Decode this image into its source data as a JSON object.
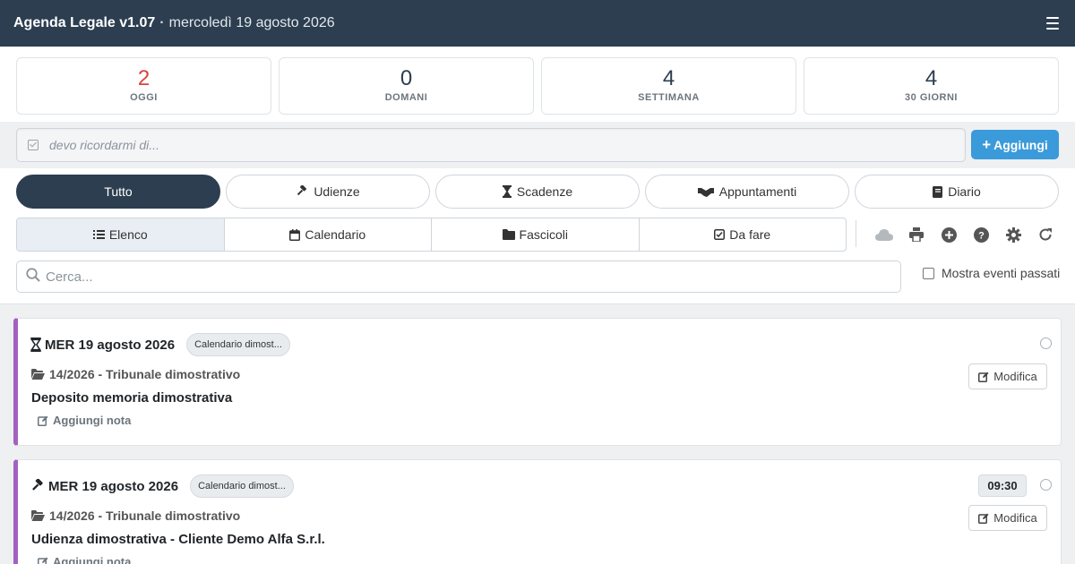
{
  "header": {
    "app_title": "Agenda Legale v1.07",
    "separator": "·",
    "current_date": "mercoledì 19 agosto 2026",
    "menu_icon": "hamburger-menu-icon"
  },
  "stats": [
    {
      "value": "2",
      "label": "OGGI",
      "color": "#d9443c"
    },
    {
      "value": "0",
      "label": "DOMANI"
    },
    {
      "value": "4",
      "label": "SETTIMANA"
    },
    {
      "value": "4",
      "label": "30 GIORNI"
    }
  ],
  "quick_add": {
    "placeholder": "devo ricordarmi di...",
    "button_label": "Aggiungi",
    "button_color": "#3b9ad9"
  },
  "filters": [
    {
      "label": "Tutto",
      "active": true
    },
    {
      "label": "Udienze",
      "icon": "gavel-icon"
    },
    {
      "label": "Scadenze",
      "icon": "hourglass-icon"
    },
    {
      "label": "Appuntamenti",
      "icon": "handshake-icon"
    },
    {
      "label": "Diario",
      "icon": "book-icon"
    }
  ],
  "views": [
    {
      "label": "Elenco",
      "icon": "list-icon",
      "active": true
    },
    {
      "label": "Calendario",
      "icon": "calendar-icon"
    },
    {
      "label": "Fascicoli",
      "icon": "folder-icon"
    },
    {
      "label": "Da fare",
      "icon": "checkbox-icon"
    }
  ],
  "toolbar_icons": [
    "cloud-icon",
    "print-icon",
    "add-circle-icon",
    "help-icon",
    "settings-icon",
    "refresh-icon"
  ],
  "search": {
    "placeholder": "Cerca..."
  },
  "show_past_label": "Mostra eventi passati",
  "events": [
    {
      "type_icon": "hourglass-icon",
      "date": "MER 19 agosto 2026",
      "calendar_tag": "Calendario dimost...",
      "case": "14/2026 - Tribunale dimostrativo",
      "subject": "Deposito memoria dimostrativa",
      "note_label": "Aggiungi nota",
      "edit_label": "Modifica",
      "accent_color": "#a361c0"
    },
    {
      "type_icon": "gavel-icon",
      "date": "MER 19 agosto 2026",
      "calendar_tag": "Calendario dimost...",
      "case": "14/2026 - Tribunale dimostrativo",
      "subject": "Udienza dimostrativa - Cliente Demo Alfa S.r.l.",
      "note_label": "Aggiungi nota",
      "edit_label": "Modifica",
      "time": "09:30",
      "accent_color": "#a361c0"
    }
  ]
}
